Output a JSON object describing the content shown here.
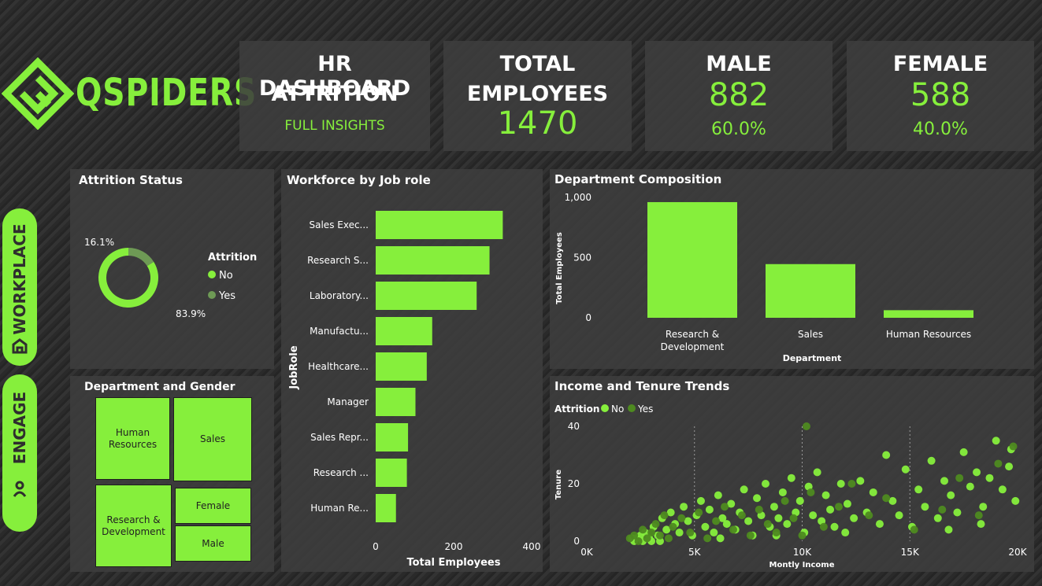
{
  "brand": {
    "name": "QSPIDERS"
  },
  "nav": {
    "workplace": "WORKPLACE",
    "engage": "ENGAGE"
  },
  "header": {
    "title_line1": "HR DASHBOARD",
    "title_line2": "ATTRITION",
    "subtitle": "FULL INSIGHTS"
  },
  "kpis": {
    "total": {
      "title_line1": "TOTAL",
      "title_line2": "EMPLOYEES",
      "value": "1470"
    },
    "male": {
      "title": "MALE",
      "value": "882",
      "pct": "60.0%"
    },
    "female": {
      "title": "FEMALE",
      "value": "588",
      "pct": "40.0%"
    }
  },
  "colors": {
    "accent": "#86ef3c",
    "attrition_no": "#86ef3c",
    "attrition_yes": "#6e9a55",
    "scatter_yes": "#4e8a20",
    "panel": "#3e3e3e"
  },
  "chart_data": [
    {
      "type": "pie",
      "title": "Attrition Status",
      "legend_title": "Attrition",
      "legend_position": "right",
      "categories": [
        "No",
        "Yes"
      ],
      "values": [
        83.9,
        16.1
      ],
      "value_labels": [
        "83.9%",
        "16.1%"
      ]
    },
    {
      "type": "bar",
      "orientation": "horizontal",
      "title": "Workforce by Job role",
      "ylabel": "JobRole",
      "xlabel": "Total Employees",
      "categories": [
        "Sales Exec...",
        "Research S...",
        "Laboratory...",
        "Manufactu...",
        "Healthcare...",
        "Manager",
        "Sales Repr...",
        "Research ...",
        "Human Re..."
      ],
      "values": [
        326,
        292,
        259,
        145,
        131,
        102,
        83,
        80,
        52
      ],
      "xlim": [
        0,
        400
      ],
      "xticks": [
        "0",
        "200",
        "400"
      ],
      "grid": false
    },
    {
      "type": "bar",
      "title": "Department Composition",
      "xlabel": "Department",
      "ylabel": "Total Employees",
      "categories": [
        "Research & Development",
        "Sales",
        "Human Resources"
      ],
      "values": [
        961,
        446,
        63
      ],
      "ylim": [
        0,
        1000
      ],
      "yticks": [
        "0",
        "500",
        "1,000"
      ],
      "grid": false
    },
    {
      "type": "table",
      "title": "Department and Gender",
      "cells": [
        "Human Resources",
        "Sales",
        "Research & Development",
        "Female",
        "Male"
      ]
    },
    {
      "type": "scatter",
      "title": "Income and Tenure Trends",
      "legend_title": "Attrition",
      "legend_position": "top-left",
      "xlabel": "Montly Income",
      "ylabel": "Tenure",
      "xlim": [
        0,
        20000
      ],
      "ylim": [
        0,
        40
      ],
      "xticks": [
        "0K",
        "5K",
        "10K",
        "15K",
        "20K"
      ],
      "yticks": [
        "0",
        "20",
        "40"
      ],
      "series": [
        {
          "name": "No",
          "points": [
            [
              2100,
              1
            ],
            [
              2300,
              1
            ],
            [
              2500,
              2
            ],
            [
              2700,
              3
            ],
            [
              2900,
              1
            ],
            [
              3100,
              5
            ],
            [
              3300,
              2
            ],
            [
              3500,
              8
            ],
            [
              3700,
              4
            ],
            [
              3900,
              10
            ],
            [
              4100,
              6
            ],
            [
              4300,
              3
            ],
            [
              4500,
              12
            ],
            [
              4700,
              7
            ],
            [
              4900,
              2
            ],
            [
              5100,
              9
            ],
            [
              5300,
              14
            ],
            [
              5500,
              5
            ],
            [
              5700,
              11
            ],
            [
              5900,
              3
            ],
            [
              6100,
              16
            ],
            [
              6300,
              8
            ],
            [
              6500,
              6
            ],
            [
              6700,
              13
            ],
            [
              6900,
              4
            ],
            [
              7100,
              10
            ],
            [
              7300,
              18
            ],
            [
              7500,
              7
            ],
            [
              7700,
              2
            ],
            [
              7900,
              15
            ],
            [
              8100,
              9
            ],
            [
              8300,
              20
            ],
            [
              8500,
              5
            ],
            [
              8700,
              12
            ],
            [
              8900,
              8
            ],
            [
              9100,
              17
            ],
            [
              9300,
              6
            ],
            [
              9500,
              22
            ],
            [
              9700,
              10
            ],
            [
              9900,
              14
            ],
            [
              10100,
              3
            ],
            [
              10300,
              19
            ],
            [
              10500,
              9
            ],
            [
              10700,
              24
            ],
            [
              10900,
              7
            ],
            [
              11100,
              16
            ],
            [
              11300,
              11
            ],
            [
              11500,
              5
            ],
            [
              11800,
              20
            ],
            [
              12100,
              13
            ],
            [
              12400,
              8
            ],
            [
              12700,
              21
            ],
            [
              13000,
              10
            ],
            [
              13300,
              17
            ],
            [
              13600,
              6
            ],
            [
              13900,
              30
            ],
            [
              14200,
              14
            ],
            [
              14500,
              9
            ],
            [
              14800,
              25
            ],
            [
              15100,
              5
            ],
            [
              15400,
              18
            ],
            [
              15700,
              12
            ],
            [
              16000,
              28
            ],
            [
              16300,
              8
            ],
            [
              16600,
              21
            ],
            [
              16900,
              16
            ],
            [
              17200,
              10
            ],
            [
              17500,
              31
            ],
            [
              17800,
              19
            ],
            [
              18100,
              24
            ],
            [
              18400,
              12
            ],
            [
              18700,
              22
            ],
            [
              19000,
              35
            ],
            [
              19300,
              18
            ],
            [
              19600,
              26
            ],
            [
              19900,
              14
            ],
            [
              2200,
              0
            ],
            [
              2600,
              0
            ],
            [
              3000,
              0
            ],
            [
              3400,
              0
            ],
            [
              6200,
              1
            ],
            [
              8800,
              2
            ],
            [
              12000,
              3
            ],
            [
              16800,
              4
            ],
            [
              18300,
              6
            ],
            [
              19700,
              32
            ]
          ]
        },
        {
          "name": "Yes",
          "points": [
            [
              2000,
              1
            ],
            [
              2200,
              2
            ],
            [
              2400,
              0
            ],
            [
              2600,
              4
            ],
            [
              2800,
              1
            ],
            [
              3000,
              3
            ],
            [
              3200,
              6
            ],
            [
              3400,
              2
            ],
            [
              3600,
              9
            ],
            [
              3800,
              1
            ],
            [
              4000,
              5
            ],
            [
              4400,
              8
            ],
            [
              4800,
              3
            ],
            [
              5200,
              10
            ],
            [
              5600,
              1
            ],
            [
              6000,
              7
            ],
            [
              6400,
              12
            ],
            [
              6800,
              4
            ],
            [
              7200,
              9
            ],
            [
              7600,
              2
            ],
            [
              8000,
              11
            ],
            [
              8400,
              6
            ],
            [
              8800,
              3
            ],
            [
              9200,
              14
            ],
            [
              9600,
              8
            ],
            [
              10000,
              2
            ],
            [
              10200,
              40
            ],
            [
              10400,
              17
            ],
            [
              11000,
              5
            ],
            [
              11700,
              12
            ],
            [
              12300,
              20
            ],
            [
              13100,
              9
            ],
            [
              13900,
              15
            ],
            [
              15200,
              4
            ],
            [
              16500,
              11
            ],
            [
              17300,
              22
            ],
            [
              18200,
              9
            ],
            [
              19100,
              27
            ],
            [
              19800,
              33
            ]
          ]
        }
      ]
    }
  ]
}
